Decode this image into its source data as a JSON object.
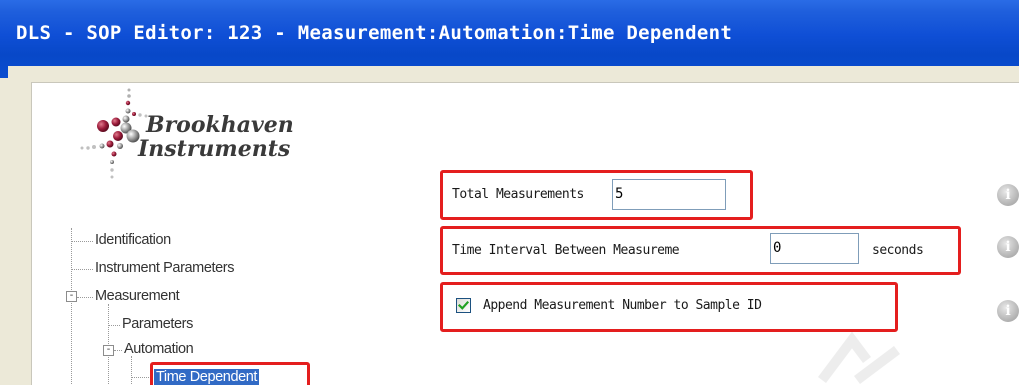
{
  "window": {
    "title": "DLS - SOP Editor: 123 - Measurement:Automation:Time Dependent"
  },
  "logo": {
    "line1": "Brookhaven",
    "line2": "Instruments"
  },
  "tree": {
    "items": [
      {
        "label": "Identification"
      },
      {
        "label": "Instrument Parameters"
      },
      {
        "label": "Measurement",
        "expander": "-"
      },
      {
        "label": "Parameters"
      },
      {
        "label": "Automation",
        "expander": "-"
      },
      {
        "label": "Time Dependent",
        "selected": true
      }
    ]
  },
  "form": {
    "total_measurements": {
      "label": "Total Measurements",
      "value": "5"
    },
    "time_interval": {
      "label": "Time Interval Between Measureme",
      "value": "0",
      "unit": "seconds"
    },
    "append_number": {
      "label": "Append Measurement Number to Sample ID",
      "checked": true
    },
    "info_glyph": "i"
  },
  "colors": {
    "titlebar": "#0a4dd0",
    "highlight": "#e41e1e",
    "selection": "#316ac5",
    "checkmark": "#21a121"
  }
}
